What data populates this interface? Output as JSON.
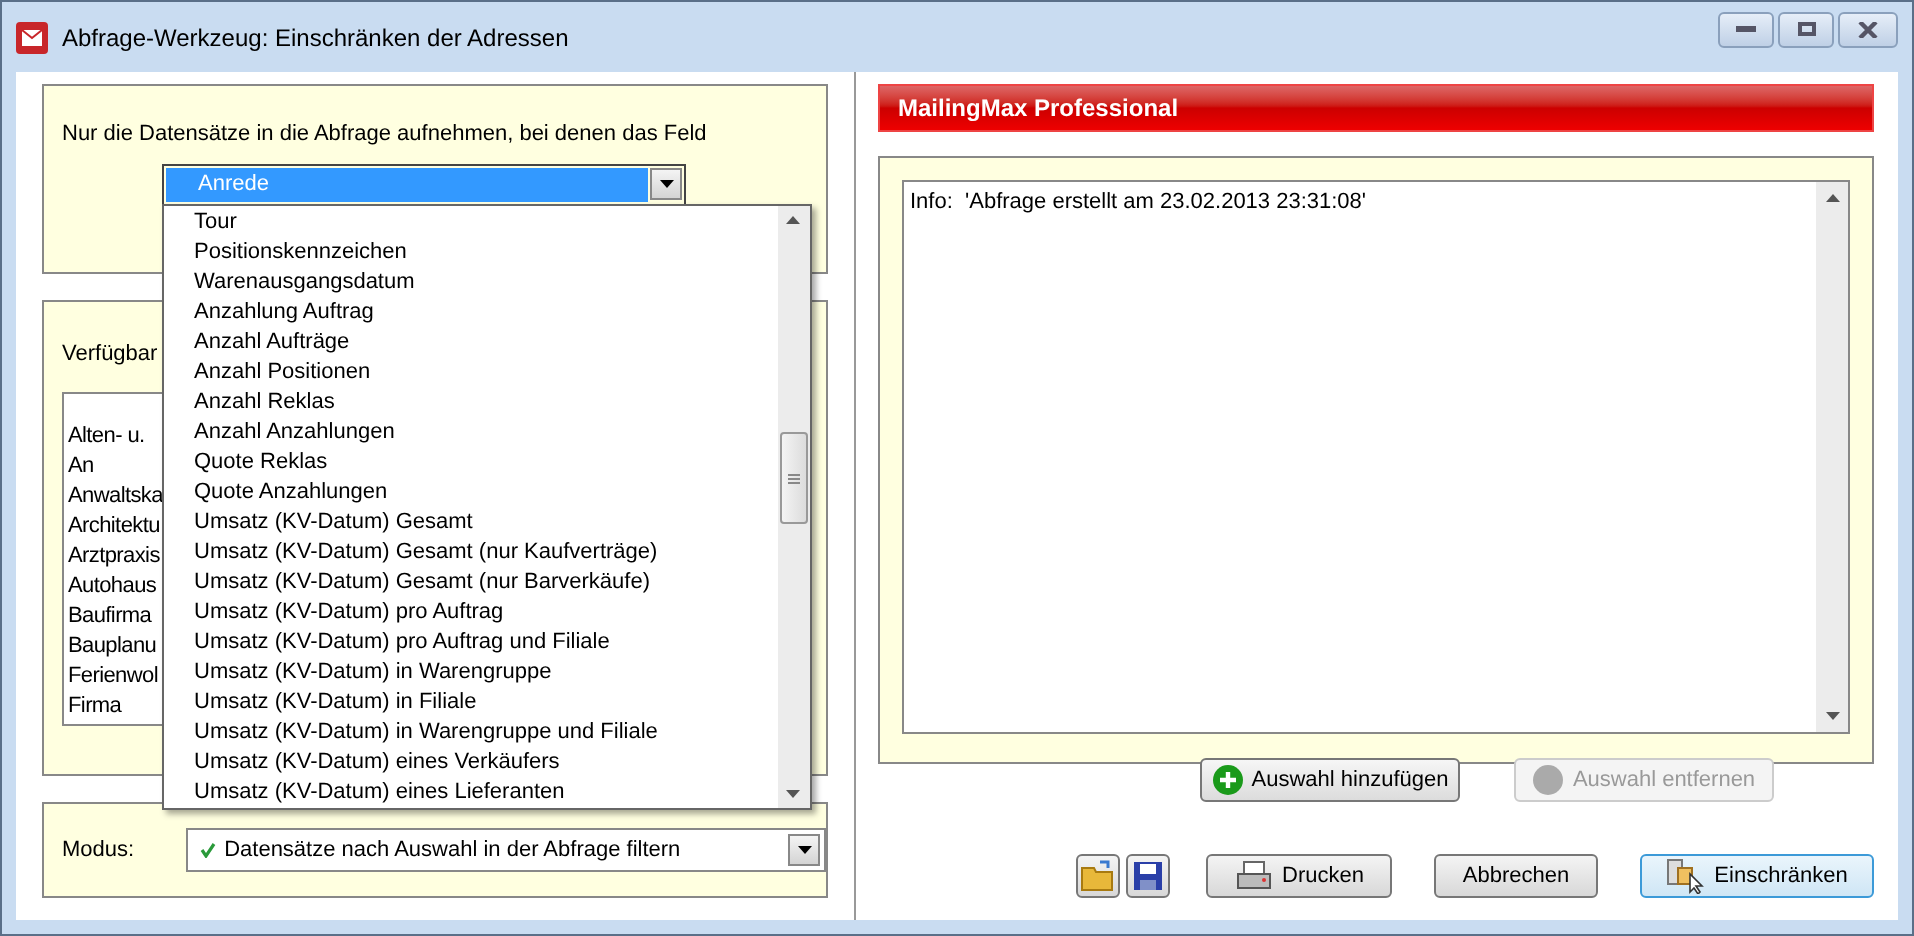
{
  "window": {
    "title": "Abfrage-Werkzeug: Einschränken der Adressen"
  },
  "field_panel": {
    "prompt": "Nur die Datensätze in die Abfrage aufnehmen, bei denen das Feld",
    "field_combo": {
      "value": "Anrede",
      "expanded": true
    },
    "dropdown_items": [
      "Tour",
      "Positionskennzeichen",
      "Warenausgangsdatum",
      "Anzahlung Auftrag",
      "Anzahl Aufträge",
      "Anzahl Positionen",
      "Anzahl Reklas",
      "Anzahl Anzahlungen",
      "Quote Reklas",
      "Quote Anzahlungen",
      "Umsatz (KV-Datum) Gesamt",
      "Umsatz (KV-Datum) Gesamt (nur Kaufverträge)",
      "Umsatz (KV-Datum) Gesamt (nur Barverkäufe)",
      "Umsatz (KV-Datum) pro Auftrag",
      "Umsatz (KV-Datum) pro Auftrag und Filiale",
      "Umsatz (KV-Datum) in Warengruppe",
      "Umsatz (KV-Datum) in Filiale",
      "Umsatz (KV-Datum) in Warengruppe und Filiale",
      "Umsatz (KV-Datum) eines Verkäufers",
      "Umsatz (KV-Datum) eines Lieferanten"
    ]
  },
  "available_panel": {
    "label": "Verfügbar",
    "items": [
      "Alten- u.",
      "An",
      "Anwaltska",
      "Architektu",
      "Arztpraxis",
      "Autohaus",
      "Baufirma",
      "Bauplanu",
      "Ferienwol",
      "Firma"
    ]
  },
  "mode": {
    "label": "Modus:",
    "value": "Datensätze nach Auswahl in der Abfrage filtern"
  },
  "header": "MailingMax Professional",
  "info": {
    "text": "Info:  'Abfrage erstellt am 23.02.2013 23:31:08'"
  },
  "selection_buttons": [
    {
      "label": "Auswahl hinzufügen",
      "disabled": false
    },
    {
      "label": "Auswahl entfernen",
      "disabled": true
    }
  ],
  "bottom_buttons": [
    {
      "kind": "open"
    },
    {
      "kind": "save"
    },
    {
      "kind": "print",
      "label": "Drucken",
      "default": false
    },
    {
      "kind": "cancel",
      "label": "Abbrechen",
      "default": false
    },
    {
      "kind": "restrict",
      "label": "Einschränken",
      "default": true
    }
  ]
}
